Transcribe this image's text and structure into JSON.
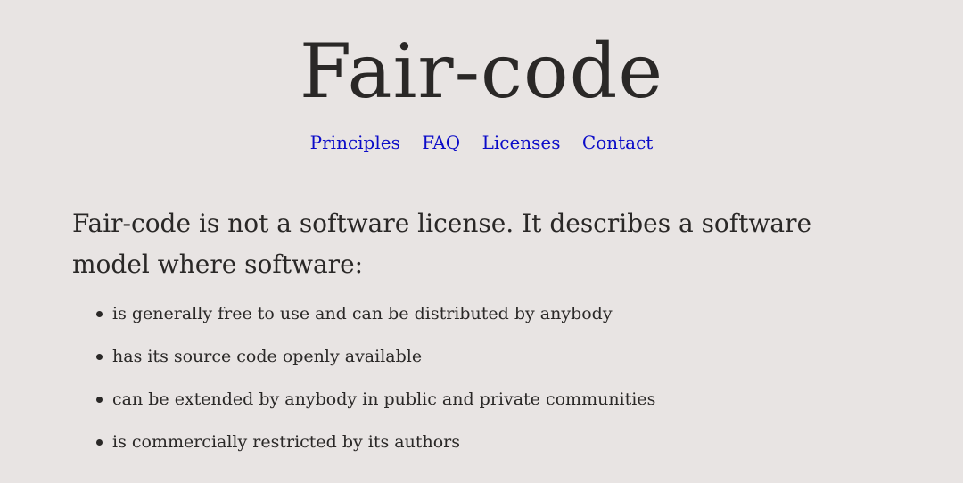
{
  "header": {
    "title": "Fair-code"
  },
  "nav": {
    "items": [
      {
        "label": "Principles"
      },
      {
        "label": "FAQ"
      },
      {
        "label": "Licenses"
      },
      {
        "label": "Contact"
      }
    ]
  },
  "main": {
    "intro": "Fair-code is not a software license. It describes a software model where software:",
    "points": [
      "is generally free to use and can be distributed by anybody",
      "has its source code openly available",
      "can be extended by anybody in public and private communities",
      "is commercially restricted by its authors"
    ]
  },
  "colors": {
    "background": "#e8e4e3",
    "text": "#2a2827",
    "link": "#0b0bc8"
  }
}
